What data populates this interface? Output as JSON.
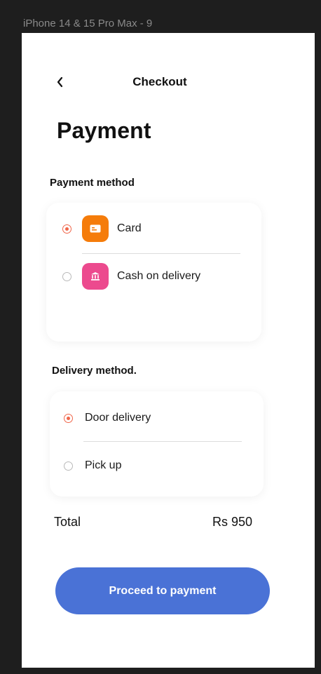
{
  "frame": {
    "label": "iPhone 14 & 15 Pro Max - 9"
  },
  "header": {
    "back_icon": "chevron-left-icon",
    "title": "Checkout"
  },
  "page": {
    "title": "Payment"
  },
  "payment": {
    "section_label": "Payment method",
    "options": [
      {
        "label": "Card",
        "selected": true,
        "icon": "credit-card-icon",
        "icon_color": "#f57c0a"
      },
      {
        "label": "Cash on delivery",
        "selected": false,
        "icon": "bank-icon",
        "icon_color": "#ec4a8e"
      }
    ]
  },
  "delivery": {
    "section_label": "Delivery method.",
    "options": [
      {
        "label": "Door delivery",
        "selected": true
      },
      {
        "label": "Pick up",
        "selected": false
      }
    ]
  },
  "summary": {
    "total_label": "Total",
    "total_value": "Rs 950"
  },
  "cta": {
    "label": "Proceed to payment",
    "color": "#4a72d6"
  },
  "colors": {
    "accent": "#f0664a"
  }
}
